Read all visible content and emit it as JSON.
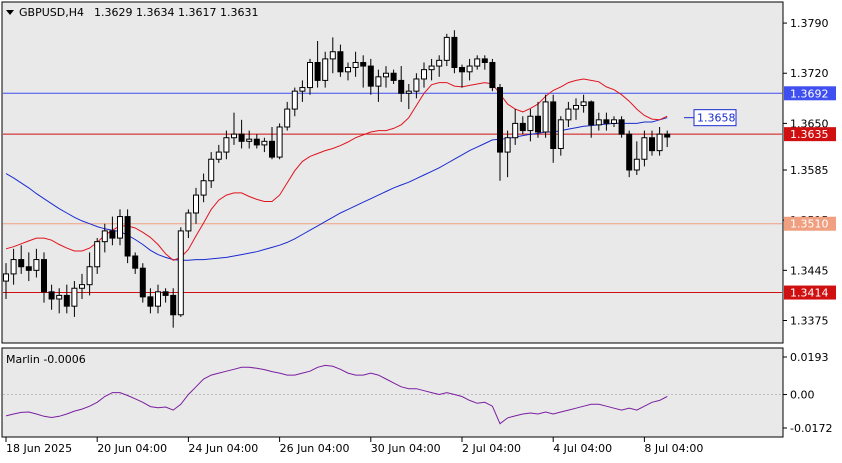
{
  "header": {
    "symbol": "GBPUSD,H4",
    "ohlc": "1.3629 1.3634 1.3617 1.3631"
  },
  "indicator": {
    "label": "Marlin -0.0006",
    "ticks": [
      "0.0193",
      "0.00",
      "-0.0172"
    ]
  },
  "price_axis": {
    "ticks": [
      "1.3790",
      "1.3720",
      "1.3650",
      "1.3585",
      "1.3515",
      "1.3445",
      "1.3375"
    ]
  },
  "time_axis": {
    "labels": [
      "18 Jun 2025",
      "20 Jun 04:00",
      "24 Jun 04:00",
      "26 Jun 04:00",
      "30 Jun 04:00",
      "2 Jul 04:00",
      "4 Jul 04:00",
      "8 Jul 04:00"
    ]
  },
  "levels": [
    {
      "label": "1.3692",
      "value": 1.3692,
      "color": "#3f4ff0",
      "badge_bg": "#3f4ff0",
      "badge_fg": "#ffffff"
    },
    {
      "label": "1.3635",
      "value": 1.3635,
      "color": "#d01010",
      "badge_bg": "#d01010",
      "badge_fg": "#ffffff"
    },
    {
      "label": "1.3510",
      "value": 1.351,
      "color": "#f0a080",
      "badge_bg": "#f0a080",
      "badge_fg": "#ffffff"
    },
    {
      "label": "1.3414",
      "value": 1.3414,
      "color": "#d01010",
      "badge_bg": "#d01010",
      "badge_fg": "#ffffff"
    }
  ],
  "ma_label": {
    "text": "1.3658",
    "value": 1.3658,
    "color": "#1a2bd0"
  },
  "colors": {
    "background": "#e9e9e9",
    "bull_candle": "#ffffff",
    "bear_candle": "#000000",
    "ma_blue": "#1a2bd0",
    "ma_red": "#e0141e",
    "oscillator": "#7a1fa0"
  },
  "chart_data": {
    "type": "candlestick",
    "symbol": "GBPUSD",
    "timeframe": "H4",
    "ylim": [
      1.3345,
      1.3818
    ],
    "candles": [
      [
        1.343,
        1.3455,
        1.3405,
        1.344
      ],
      [
        1.344,
        1.3475,
        1.3425,
        1.346
      ],
      [
        1.346,
        1.348,
        1.344,
        1.345
      ],
      [
        1.345,
        1.347,
        1.343,
        1.3445
      ],
      [
        1.3445,
        1.3475,
        1.3435,
        1.346
      ],
      [
        1.346,
        1.347,
        1.34,
        1.3415
      ],
      [
        1.3415,
        1.3425,
        1.339,
        1.3405
      ],
      [
        1.3405,
        1.342,
        1.3385,
        1.341
      ],
      [
        1.341,
        1.3425,
        1.3385,
        1.3395
      ],
      [
        1.3395,
        1.343,
        1.338,
        1.342
      ],
      [
        1.342,
        1.344,
        1.3405,
        1.3425
      ],
      [
        1.3425,
        1.347,
        1.341,
        1.345
      ],
      [
        1.345,
        1.349,
        1.344,
        1.3485
      ],
      [
        1.3485,
        1.351,
        1.347,
        1.35
      ],
      [
        1.35,
        1.352,
        1.348,
        1.349
      ],
      [
        1.349,
        1.353,
        1.348,
        1.352
      ],
      [
        1.352,
        1.353,
        1.3455,
        1.3465
      ],
      [
        1.3465,
        1.347,
        1.344,
        1.3448
      ],
      [
        1.3448,
        1.3455,
        1.34,
        1.3408
      ],
      [
        1.3408,
        1.342,
        1.3385,
        1.3395
      ],
      [
        1.3395,
        1.3425,
        1.3385,
        1.3415
      ],
      [
        1.3415,
        1.342,
        1.34,
        1.341
      ],
      [
        1.341,
        1.342,
        1.3365,
        1.3383
      ],
      [
        1.3383,
        1.3505,
        1.338,
        1.35
      ],
      [
        1.35,
        1.353,
        1.349,
        1.3525
      ],
      [
        1.3525,
        1.356,
        1.351,
        1.355
      ],
      [
        1.355,
        1.358,
        1.354,
        1.357
      ],
      [
        1.357,
        1.361,
        1.356,
        1.36
      ],
      [
        1.36,
        1.362,
        1.3595,
        1.361
      ],
      [
        1.361,
        1.364,
        1.36,
        1.363
      ],
      [
        1.363,
        1.3665,
        1.362,
        1.3635
      ],
      [
        1.3635,
        1.3655,
        1.3615,
        1.3625
      ],
      [
        1.3625,
        1.364,
        1.3615,
        1.3628
      ],
      [
        1.3628,
        1.3635,
        1.3615,
        1.362
      ],
      [
        1.362,
        1.363,
        1.361,
        1.3625
      ],
      [
        1.3625,
        1.3645,
        1.36,
        1.3603
      ],
      [
        1.3603,
        1.365,
        1.36,
        1.3645
      ],
      [
        1.3645,
        1.368,
        1.364,
        1.367
      ],
      [
        1.367,
        1.37,
        1.366,
        1.3695
      ],
      [
        1.3695,
        1.371,
        1.368,
        1.37
      ],
      [
        1.37,
        1.374,
        1.369,
        1.3735
      ],
      [
        1.3735,
        1.3765,
        1.37,
        1.371
      ],
      [
        1.371,
        1.375,
        1.37,
        1.374
      ],
      [
        1.374,
        1.377,
        1.372,
        1.375
      ],
      [
        1.375,
        1.376,
        1.3715,
        1.3722
      ],
      [
        1.3722,
        1.3735,
        1.371,
        1.3728
      ],
      [
        1.3728,
        1.375,
        1.3715,
        1.3735
      ],
      [
        1.3735,
        1.3745,
        1.37,
        1.373
      ],
      [
        1.373,
        1.374,
        1.369,
        1.3702
      ],
      [
        1.3702,
        1.3725,
        1.368,
        1.3715
      ],
      [
        1.3715,
        1.373,
        1.37,
        1.372
      ],
      [
        1.372,
        1.3725,
        1.3705,
        1.371
      ],
      [
        1.371,
        1.373,
        1.368,
        1.3692
      ],
      [
        1.3692,
        1.3705,
        1.367,
        1.3695
      ],
      [
        1.3695,
        1.372,
        1.3685,
        1.3712
      ],
      [
        1.3712,
        1.3735,
        1.37,
        1.3725
      ],
      [
        1.3725,
        1.374,
        1.371,
        1.373
      ],
      [
        1.373,
        1.3745,
        1.3715,
        1.3738
      ],
      [
        1.3738,
        1.3775,
        1.373,
        1.377
      ],
      [
        1.377,
        1.378,
        1.372,
        1.3728
      ],
      [
        1.3728,
        1.3732,
        1.37,
        1.3722
      ],
      [
        1.3722,
        1.374,
        1.371,
        1.373
      ],
      [
        1.373,
        1.3745,
        1.3725,
        1.374
      ],
      [
        1.374,
        1.3745,
        1.3725,
        1.3735
      ],
      [
        1.3735,
        1.374,
        1.3695,
        1.37
      ],
      [
        1.37,
        1.3705,
        1.357,
        1.361
      ],
      [
        1.361,
        1.364,
        1.3575,
        1.363
      ],
      [
        1.363,
        1.367,
        1.362,
        1.365
      ],
      [
        1.365,
        1.366,
        1.3635,
        1.364
      ],
      [
        1.364,
        1.367,
        1.3625,
        1.366
      ],
      [
        1.366,
        1.368,
        1.363,
        1.3638
      ],
      [
        1.3638,
        1.369,
        1.363,
        1.368
      ],
      [
        1.368,
        1.369,
        1.3595,
        1.3615
      ],
      [
        1.3615,
        1.366,
        1.3605,
        1.3655
      ],
      [
        1.3655,
        1.368,
        1.3645,
        1.367
      ],
      [
        1.367,
        1.3685,
        1.3655,
        1.3675
      ],
      [
        1.3675,
        1.369,
        1.3665,
        1.368
      ],
      [
        1.368,
        1.3682,
        1.363,
        1.3648
      ],
      [
        1.3648,
        1.3665,
        1.364,
        1.3655
      ],
      [
        1.3655,
        1.3665,
        1.364,
        1.365
      ],
      [
        1.365,
        1.366,
        1.3645,
        1.3655
      ],
      [
        1.3655,
        1.366,
        1.363,
        1.3635
      ],
      [
        1.3635,
        1.364,
        1.3575,
        1.3585
      ],
      [
        1.3585,
        1.3625,
        1.3578,
        1.36
      ],
      [
        1.36,
        1.364,
        1.359,
        1.363
      ],
      [
        1.363,
        1.364,
        1.3605,
        1.3612
      ],
      [
        1.3612,
        1.3645,
        1.3605,
        1.3635
      ],
      [
        1.3635,
        1.364,
        1.3617,
        1.3631
      ]
    ],
    "lines": [
      {
        "color": "#1a2bd0",
        "values": [
          1.358,
          1.3574,
          1.3567,
          1.356,
          1.3552,
          1.3545,
          1.3538,
          1.3531,
          1.3525,
          1.3519,
          1.3514,
          1.351,
          1.3506,
          1.3503,
          1.3501,
          1.3499,
          1.3494,
          1.3488,
          1.3481,
          1.3473,
          1.3467,
          1.3463,
          1.346,
          1.3459,
          1.3459,
          1.346,
          1.346,
          1.3461,
          1.3462,
          1.3463,
          1.3465,
          1.3467,
          1.3469,
          1.3471,
          1.3474,
          1.3477,
          1.348,
          1.3484,
          1.3489,
          1.3495,
          1.3501,
          1.3507,
          1.3513,
          1.3519,
          1.3525,
          1.353,
          1.3535,
          1.354,
          1.3545,
          1.355,
          1.3555,
          1.356,
          1.3564,
          1.3568,
          1.3573,
          1.3578,
          1.3583,
          1.3588,
          1.3594,
          1.36,
          1.3606,
          1.3612,
          1.3617,
          1.3622,
          1.3627,
          1.3628,
          1.3629,
          1.3631,
          1.3633,
          1.3635,
          1.3636,
          1.3638,
          1.3638,
          1.364,
          1.3642,
          1.3644,
          1.3646,
          1.3647,
          1.3648,
          1.3649,
          1.365,
          1.365,
          1.365,
          1.365,
          1.3652,
          1.3652,
          1.3655,
          1.3658
        ]
      },
      {
        "color": "#e0141e",
        "values": [
          1.3475,
          1.3478,
          1.3482,
          1.3486,
          1.349,
          1.349,
          1.3487,
          1.3481,
          1.3476,
          1.3472,
          1.3472,
          1.3476,
          1.3484,
          1.3494,
          1.3501,
          1.3507,
          1.3507,
          1.3504,
          1.3498,
          1.3491,
          1.3481,
          1.3468,
          1.3459,
          1.3463,
          1.3474,
          1.3493,
          1.3511,
          1.353,
          1.3543,
          1.355,
          1.3553,
          1.3553,
          1.3548,
          1.3544,
          1.3541,
          1.3541,
          1.355,
          1.3567,
          1.3584,
          1.3597,
          1.3604,
          1.3608,
          1.3612,
          1.3615,
          1.3619,
          1.3624,
          1.363,
          1.3634,
          1.3638,
          1.364,
          1.364,
          1.3643,
          1.3648,
          1.3658,
          1.3675,
          1.3692,
          1.3704,
          1.3707,
          1.3707,
          1.3702,
          1.3701,
          1.3703,
          1.3705,
          1.3707,
          1.3705,
          1.3691,
          1.3677,
          1.367,
          1.3666,
          1.3671,
          1.3677,
          1.3688,
          1.3696,
          1.3701,
          1.3707,
          1.371,
          1.3712,
          1.371,
          1.3708,
          1.3701,
          1.3697,
          1.369,
          1.3681,
          1.367,
          1.3661,
          1.3656,
          1.3655,
          1.366
        ]
      }
    ],
    "oscillator": {
      "ylim": [
        -0.0172,
        0.0193
      ],
      "values": [
        -0.011,
        -0.01,
        -0.0092,
        -0.009,
        -0.01,
        -0.0112,
        -0.0118,
        -0.0112,
        -0.01,
        -0.0085,
        -0.0075,
        -0.006,
        -0.004,
        -0.001,
        0.001,
        0.001,
        -0.0005,
        -0.0022,
        -0.004,
        -0.0062,
        -0.0068,
        -0.0064,
        -0.008,
        -0.005,
        0.0,
        0.004,
        0.008,
        0.01,
        0.011,
        0.012,
        0.013,
        0.014,
        0.014,
        0.0135,
        0.0128,
        0.0118,
        0.011,
        0.01,
        0.01,
        0.011,
        0.012,
        0.014,
        0.015,
        0.0145,
        0.013,
        0.011,
        0.01,
        0.01,
        0.011,
        0.01,
        0.008,
        0.006,
        0.004,
        0.003,
        0.003,
        0.002,
        0.001,
        0.0,
        0.001,
        0.0,
        -0.001,
        -0.003,
        -0.0045,
        -0.004,
        -0.006,
        -0.015,
        -0.012,
        -0.011,
        -0.01,
        -0.0095,
        -0.01,
        -0.009,
        -0.01,
        -0.009,
        -0.008,
        -0.007,
        -0.006,
        -0.005,
        -0.005,
        -0.006,
        -0.007,
        -0.008,
        -0.007,
        -0.008,
        -0.006,
        -0.004,
        -0.003,
        -0.001
      ]
    }
  }
}
